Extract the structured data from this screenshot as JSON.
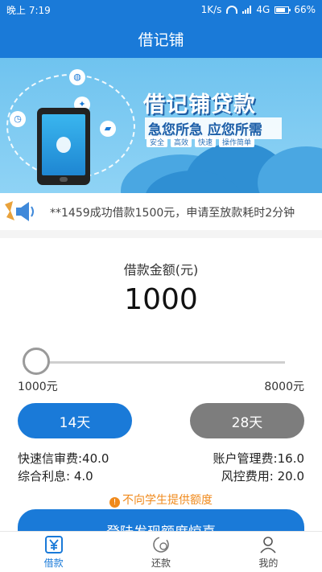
{
  "status_bar": {
    "time": "晚上 7:19",
    "speed": "1K/s",
    "network": "4G",
    "battery": "66%"
  },
  "app_bar": {
    "title": "借记铺"
  },
  "banner": {
    "title": "借记铺贷款",
    "slogan": "急您所急 应您所需",
    "tags": [
      "安全",
      "高效",
      "快速",
      "操作简单"
    ]
  },
  "notice": {
    "text": "**1459成功借款1500元，申请至放款耗时2分钟"
  },
  "loan": {
    "amount_label": "借款金额(元)",
    "amount_value": "1000",
    "min_label": "1000元",
    "max_label": "8000元",
    "slider_fraction": 0.0,
    "terms": [
      {
        "label": "14天",
        "selected": true
      },
      {
        "label": "28天",
        "selected": false
      }
    ],
    "fees": {
      "quick_review": "快速信审费:40.0",
      "account_mgmt": "账户管理费:16.0",
      "interest": "综合利息: 4.0",
      "risk_control": "风控费用: 20.0"
    },
    "warning": "不向学生提供额度",
    "cta_label": "登陆发现额度惊喜"
  },
  "tabbar": {
    "items": [
      {
        "label": "借款",
        "active": true
      },
      {
        "label": "还款",
        "active": false
      },
      {
        "label": "我的",
        "active": false
      }
    ]
  },
  "colors": {
    "primary": "#1a7ad8",
    "inactive_button": "#7d7d7d",
    "warning": "#f08a1c"
  }
}
